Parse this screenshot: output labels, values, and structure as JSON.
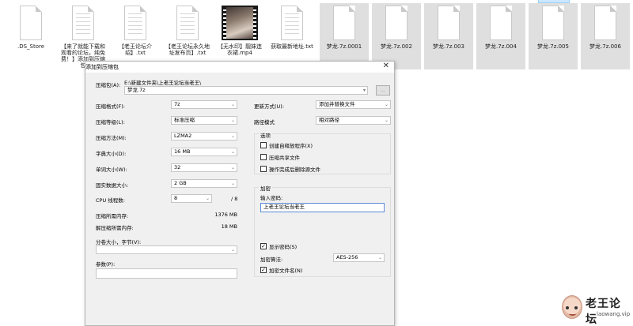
{
  "files": [
    {
      "name": ".DS_Store",
      "kind": "blank"
    },
    {
      "name": "【来了就能下载和观看的论坛，纯免费！】添加到压缩包",
      "kind": "text"
    },
    {
      "name": "【老王论坛介绍】.txt",
      "kind": "text"
    },
    {
      "name": "【老王论坛永久地址发布页】.txt",
      "kind": "text"
    },
    {
      "name": "【无水印】靓妹连衣裙.mp4",
      "kind": "video"
    },
    {
      "name": "获取最新地址.txt",
      "kind": "text"
    },
    {
      "name": "梦龙.7z.0001",
      "kind": "blank"
    },
    {
      "name": "梦龙.7z.002",
      "kind": "blank"
    },
    {
      "name": "梦龙.7z.003",
      "kind": "blank"
    },
    {
      "name": "梦龙.7z.004",
      "kind": "blank"
    },
    {
      "name": "梦龙.7z.005",
      "kind": "blank"
    },
    {
      "name": "梦龙.7z.006",
      "kind": "blank"
    }
  ],
  "dialog": {
    "title": "添加到压缩包",
    "archive_label": "压缩包(A):",
    "archive_path": "E:\\新建文件夹\\上老王论坛当老王\\",
    "archive_name": "梦龙.7z",
    "browse_label": "...",
    "format_label": "压缩格式(F):",
    "format_value": "7z",
    "level_label": "压缩等级(L):",
    "level_value": "标准压缩",
    "method_label": "压缩方法(M):",
    "method_value": "LZMA2",
    "dict_label": "字典大小(D):",
    "dict_value": "16 MB",
    "word_label": "单词大小(W):",
    "word_value": "32",
    "solid_label": "固实数据大小:",
    "solid_value": "2 GB",
    "cpu_label": "CPU 线程数:",
    "cpu_value": "8",
    "cpu_total": "/ 8",
    "mem_comp_label": "压缩所需内存:",
    "mem_comp_value": "1376 MB",
    "mem_decomp_label": "解压缩所需内存:",
    "mem_decomp_value": "18 MB",
    "split_label": "分卷大小，字节(V):",
    "split_value": "",
    "params_label": "参数(P):",
    "params_value": "",
    "update_label": "更新方式(U):",
    "update_value": "添加并替换文件",
    "path_label": "路径模式",
    "path_value": "相对路径",
    "options_title": "选项",
    "opt_sfx": "创建自释放程序(X)",
    "opt_shared": "压缩共享文件",
    "opt_delete": "操作完成后删除源文件",
    "enc_title": "加密",
    "pwd_label": "输入密码:",
    "pwd_value": "上老王论坛当老王",
    "show_pwd": "显示密码(S)",
    "enc_method_label": "加密算法:",
    "enc_method_value": "AES-256",
    "enc_names": "加密文件名(N)"
  },
  "watermark": {
    "brand": "老王论坛",
    "domain": "laowang.vip"
  }
}
